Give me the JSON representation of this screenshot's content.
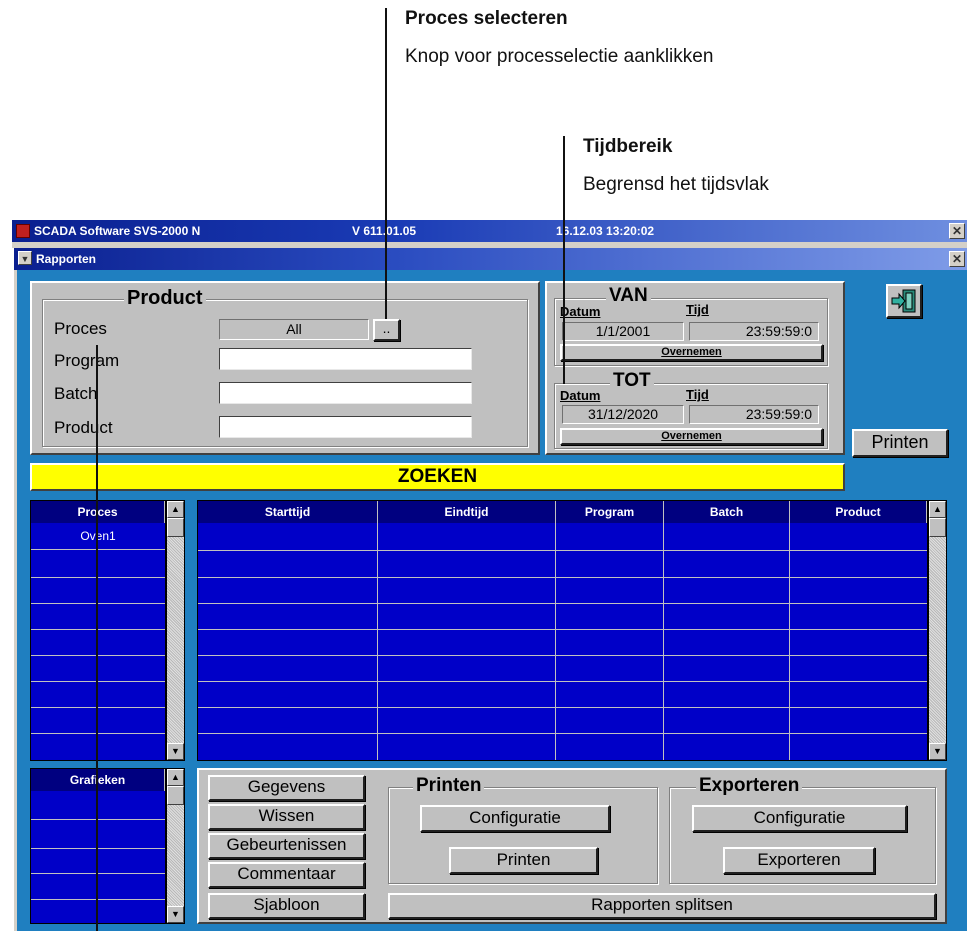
{
  "callouts": {
    "proces_title": "Proces selecteren",
    "proces_sub": "Knop voor processelectie aanklikken",
    "tijd_title": "Tijdbereik",
    "tijd_sub": "Begrensd het tijdsvlak"
  },
  "titlebar": {
    "app": "SCADA Software  SVS-2000 N",
    "version": "V 611.01.05",
    "datetime": "16.12.03  13:20:02"
  },
  "window": {
    "title": "Rapporten"
  },
  "product": {
    "group_label": "Product",
    "proces_label": "Proces",
    "proces_value": "All",
    "select_button": "..",
    "program_label": "Program",
    "batch_label": "Batch",
    "product_label": "Product",
    "program_value": "",
    "batch_value": "",
    "product_value": ""
  },
  "van": {
    "label": "VAN",
    "datum_label": "Datum",
    "tijd_label": "Tijd",
    "datum": "1/1/2001",
    "tijd": "23:59:59:0",
    "button": "Overnemen"
  },
  "tot": {
    "label": "TOT",
    "datum_label": "Datum",
    "tijd_label": "Tijd",
    "datum": "31/12/2020",
    "tijd": "23:59:59:0",
    "button": "Overnemen"
  },
  "printen_button": "Printen",
  "zoeken_button": "ZOEKEN",
  "proces_list": {
    "header": "Proces",
    "items": [
      "Oven1"
    ]
  },
  "results": {
    "columns": [
      "Starttijd",
      "Eindtijd",
      "Program",
      "Batch",
      "Product"
    ]
  },
  "grafieken": {
    "header": "Grafieken"
  },
  "actions": {
    "gegevens": "Gegevens",
    "wissen": "Wissen",
    "gebeurtenissen": "Gebeurtenissen",
    "commentaar": "Commentaar",
    "sjabloon": "Sjabloon",
    "printen_group": "Printen",
    "printen_config": "Configuratie",
    "printen_btn": "Printen",
    "export_group": "Exporteren",
    "export_config": "Configuratie",
    "export_btn": "Exporteren",
    "splitsen": "Rapporten splitsen"
  },
  "colors": {
    "background": "#1f7fc0",
    "grid": "#0000c8",
    "zoeken": "#ffff00"
  }
}
